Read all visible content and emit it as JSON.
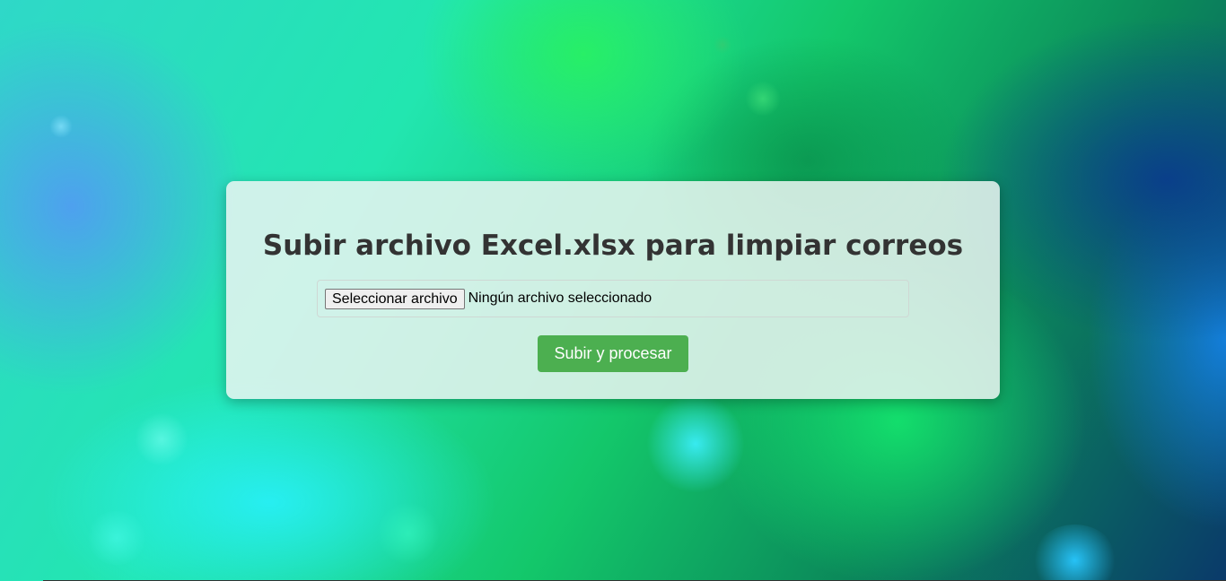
{
  "form": {
    "title": "Subir archivo Excel.xlsx para limpiar correos",
    "file_button_label": "Seleccionar archivo",
    "file_status": "Ningún archivo seleccionado",
    "submit_label": "Subir y procesar"
  },
  "colors": {
    "submit_button": "#4caf50",
    "title_text": "#333333"
  }
}
